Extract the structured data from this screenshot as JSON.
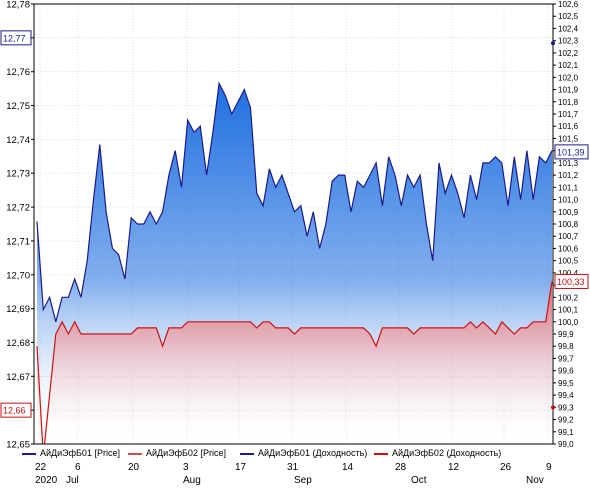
{
  "colors": {
    "blue_line": "#1a1a8c",
    "blue_fill_top": "#1f6fe0",
    "red_line": "#d01010",
    "red_fill_top": "#f06060",
    "grid": "#c8c8c8",
    "left_marker_blue": "#1a1a8c",
    "left_marker_red": "#c01010"
  },
  "legend": [
    {
      "label": "АйДиЭфБ01 [Price]",
      "color": "#1a1a8c"
    },
    {
      "label": "АйДиЭфБ02 [Price]",
      "color": "#d05050"
    },
    {
      "label": "АйДиЭфБ01 (Доходность)",
      "color": "#1a1a8c"
    },
    {
      "label": "АйДиЭфБ02 (Доходность)",
      "color": "#d01010"
    }
  ],
  "markers": {
    "left_blue": "12,77",
    "left_red": "12,66",
    "right_blue": "101,39",
    "right_red": "100,33"
  },
  "chart_data": {
    "type": "area",
    "x_day_ticks": [
      "22",
      "6",
      "20",
      "3",
      "17",
      "31",
      "14",
      "28",
      "12",
      "26",
      "9"
    ],
    "x_month_labels": [
      "2020",
      "Jul",
      "Aug",
      "Sep",
      "Oct",
      "Nov"
    ],
    "left_axis": {
      "ylim": [
        12.65,
        12.78
      ],
      "ticks": [
        "12,78",
        "12,77",
        "12,76",
        "12,75",
        "12,74",
        "12,73",
        "12,72",
        "12,71",
        "12,70",
        "12,69",
        "12,68",
        "12,67",
        "12,66",
        "12,65"
      ]
    },
    "right_axis": {
      "ylim": [
        99.0,
        102.6
      ],
      "ticks": [
        "102,6",
        "102,5",
        "102,4",
        "102,3",
        "102,2",
        "102,1",
        "102,0",
        "101,9",
        "101,8",
        "101,7",
        "101,6",
        "101,5",
        "101,4",
        "101,3",
        "101,2",
        "101,1",
        "101,0",
        "100,9",
        "100,8",
        "100,7",
        "100,6",
        "100,5",
        "100,4",
        "100,3",
        "100,2",
        "100,1",
        "100,0",
        "99,9",
        "99,8",
        "99,7",
        "99,6",
        "99,5",
        "99,4",
        "99,3",
        "99,2",
        "99,1",
        "99,0"
      ]
    },
    "series": [
      {
        "name": "АйДиЭфБ01 [Price]",
        "axis": "right",
        "values": [
          100.82,
          100.1,
          100.2,
          100.0,
          100.2,
          100.2,
          100.35,
          100.2,
          100.5,
          101.0,
          101.45,
          100.9,
          100.6,
          100.55,
          100.35,
          100.85,
          100.8,
          100.8,
          100.9,
          100.8,
          100.9,
          101.2,
          101.4,
          101.1,
          101.65,
          101.55,
          101.6,
          101.2,
          101.55,
          101.95,
          101.85,
          101.7,
          101.8,
          101.9,
          101.75,
          101.05,
          100.95,
          101.25,
          101.1,
          101.2,
          101.05,
          100.9,
          100.95,
          100.7,
          100.9,
          100.6,
          100.8,
          101.15,
          101.2,
          101.2,
          100.9,
          101.15,
          101.1,
          101.2,
          101.3,
          100.95,
          101.35,
          101.2,
          100.95,
          101.2,
          101.1,
          101.2,
          100.8,
          100.5,
          101.3,
          101.05,
          101.2,
          101.05,
          100.85,
          101.2,
          101.0,
          101.3,
          101.3,
          101.35,
          101.3,
          100.95,
          101.35,
          101.0,
          101.4,
          101.0,
          101.35,
          101.3,
          101.4
        ]
      },
      {
        "name": "АйДиЭфБ02 [Price]",
        "axis": "right",
        "values": [
          99.8,
          98.9,
          99.4,
          99.9,
          100.0,
          99.9,
          100.0,
          99.9,
          99.9,
          99.9,
          99.9,
          99.9,
          99.9,
          99.9,
          99.9,
          99.9,
          99.95,
          99.95,
          99.95,
          99.95,
          99.8,
          99.95,
          99.95,
          99.95,
          100.0,
          100.0,
          100.0,
          100.0,
          100.0,
          100.0,
          100.0,
          100.0,
          100.0,
          100.0,
          100.0,
          99.95,
          100.0,
          100.0,
          99.95,
          99.95,
          99.95,
          99.9,
          99.95,
          99.95,
          99.95,
          99.95,
          99.95,
          99.95,
          99.95,
          99.95,
          99.95,
          99.95,
          99.95,
          99.9,
          99.8,
          99.95,
          99.95,
          99.95,
          99.95,
          99.95,
          99.9,
          99.95,
          99.95,
          99.95,
          99.95,
          99.95,
          99.95,
          99.95,
          99.95,
          100.0,
          99.95,
          100.0,
          99.95,
          99.9,
          100.0,
          99.95,
          99.9,
          99.95,
          99.95,
          100.0,
          100.0,
          100.0,
          100.33
        ]
      }
    ]
  }
}
